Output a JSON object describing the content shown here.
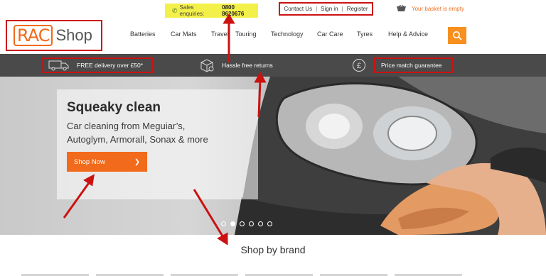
{
  "topbar": {
    "sales_label": "Sales enquiries:",
    "sales_number": "0800 8620676",
    "links": [
      "Contact Us",
      "Sign in",
      "Register"
    ],
    "separator": "|",
    "basket_text": "Your basket is empty"
  },
  "header": {
    "logo_mark": "RAC",
    "logo_text": "Shop",
    "nav": [
      "Batteries",
      "Car Mats",
      "Travel",
      "Touring",
      "Technology",
      "Car Care",
      "Tyres",
      "Help & Advice"
    ],
    "search_icon": "search-icon"
  },
  "benefits": {
    "items": [
      "FREE delivery over £50*",
      "Hassle free returns",
      "Price match guarantee"
    ],
    "pound_symbol": "£"
  },
  "hero": {
    "title": "Squeaky clean",
    "subtitle": "Car cleaning from Meguiar’s, Autoglym, Armorall, Sonax & more",
    "cta": "Shop Now",
    "cta_arrow": "❯",
    "slides": 6,
    "active_slide": 2
  },
  "brands": {
    "title": "Shop by brand"
  },
  "colors": {
    "accent": "#f26a1b",
    "annotation": "#cc1111",
    "benefit_bar": "#4a4a4a",
    "sales_highlight": "#f3f04a"
  }
}
